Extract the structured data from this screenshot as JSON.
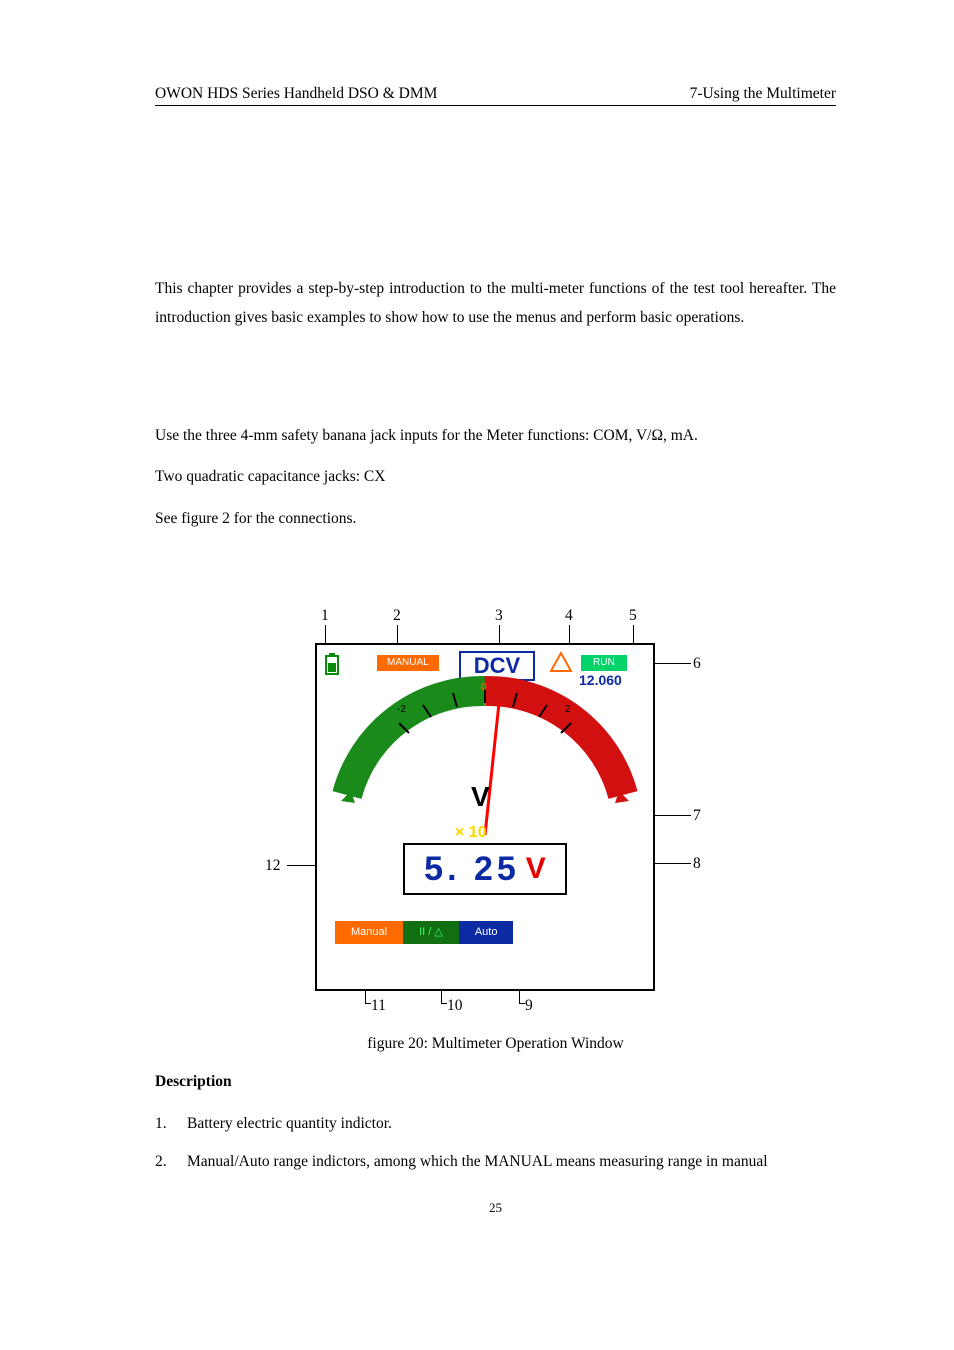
{
  "header": {
    "left": "OWON    HDS Series Handheld DSO & DMM",
    "right": "7-Using the Multimeter"
  },
  "intro": "This chapter provides a step-by-step introduction to the multi-meter functions of the test tool hereafter. The introduction gives basic examples to show how to use the menus and perform basic operations.",
  "meter_connect": {
    "line1": "Use the three 4-mm safety banana jack inputs for the Meter functions: COM, V/Ω, mA.",
    "line2": "Two quadratic capacitance jacks: CX",
    "line3": "See figure 2 for the connections."
  },
  "figure": {
    "caption": "figure 20: Multimeter Operation Window",
    "callouts": {
      "c1": "1",
      "c2": "2",
      "c3": "3",
      "c4": "4",
      "c5": "5",
      "c6": "6",
      "c7": "7",
      "c8": "8",
      "c9": "9",
      "c10": "10",
      "c11": "11",
      "c12": "12"
    },
    "screen": {
      "manual_chip": "MANUAL",
      "mode": "DCV",
      "run_chip": "RUN",
      "range": "12.060",
      "scale_zero": "0",
      "scale_neg": "-2",
      "scale_pos": "2",
      "center_letter": "V",
      "multiplier": "× 10",
      "reading_value": "5. 25",
      "reading_unit": "V",
      "tab_manual": "Manual",
      "tab_rel": "II / △",
      "tab_auto": "Auto"
    }
  },
  "description": {
    "heading": "Description",
    "items": [
      {
        "n": "1.",
        "t": "Battery electric quantity indictor."
      },
      {
        "n": "2.",
        "t": "Manual/Auto range indictors, among which the MANUAL means measuring range in manual"
      }
    ]
  },
  "page_number": "25"
}
